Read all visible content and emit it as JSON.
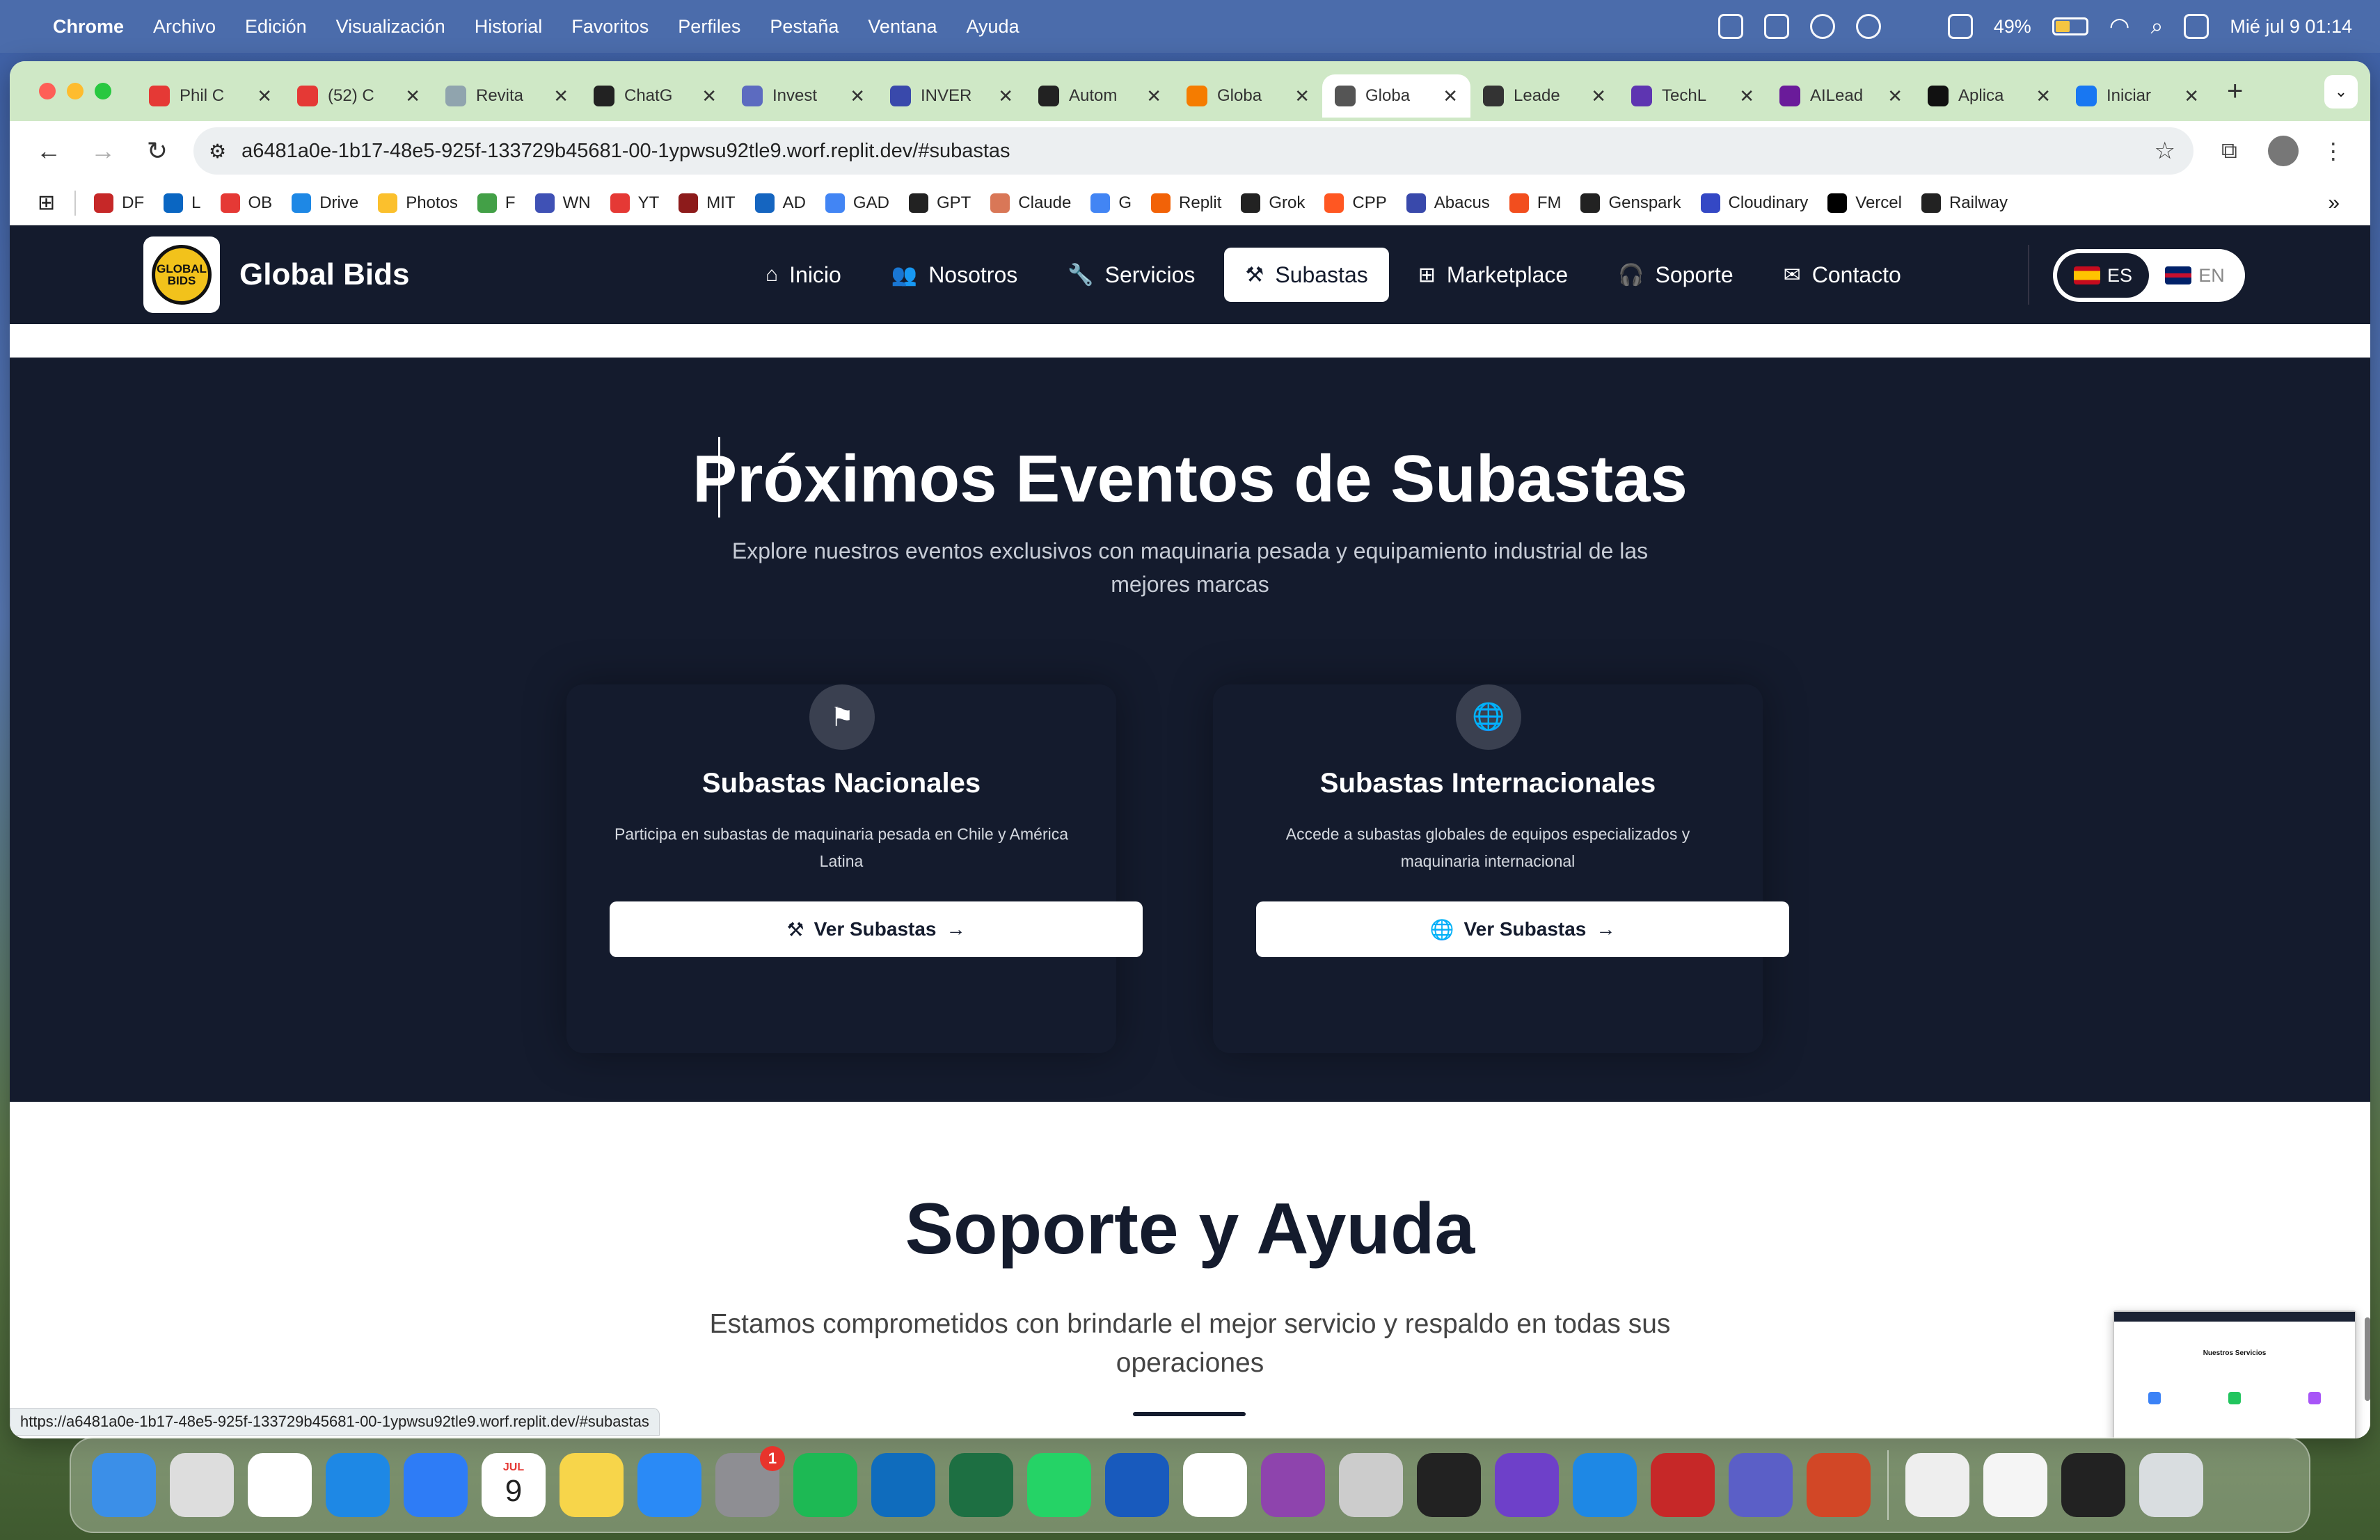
{
  "menubar": {
    "app_name": "Chrome",
    "items": [
      "Archivo",
      "Edición",
      "Visualización",
      "Historial",
      "Favoritos",
      "Perfiles",
      "Pestaña",
      "Ventana",
      "Ayuda"
    ],
    "battery_pct": "49%",
    "datetime": "Mié jul 9  01:14"
  },
  "tabs": [
    {
      "title": "Phil C",
      "color": "#e53935"
    },
    {
      "title": "(52) C",
      "color": "#e53935"
    },
    {
      "title": "Revita",
      "color": "#90a4ae"
    },
    {
      "title": "ChatG",
      "color": "#222"
    },
    {
      "title": "Invest",
      "color": "#5c6bc0"
    },
    {
      "title": "INVER",
      "color": "#3949ab"
    },
    {
      "title": "Autom",
      "color": "#222"
    },
    {
      "title": "Globa",
      "color": "#f57c00"
    },
    {
      "title": "Globa",
      "color": "#555",
      "active": true
    },
    {
      "title": "Leade",
      "color": "#333"
    },
    {
      "title": "TechL",
      "color": "#5e35b1"
    },
    {
      "title": "AILead",
      "color": "#6a1b9a"
    },
    {
      "title": "Aplica",
      "color": "#111"
    },
    {
      "title": "Iniciar",
      "color": "#1877f2"
    }
  ],
  "address_bar": {
    "url": "a6481a0e-1b17-48e5-925f-133729b45681-00-1ypwsu92tle9.worf.replit.dev/#subastas"
  },
  "bookmarks": [
    {
      "label": "DF",
      "color": "#c62828"
    },
    {
      "label": "L",
      "color": "#0a66c2"
    },
    {
      "label": "OB",
      "color": "#e53935"
    },
    {
      "label": "Drive",
      "color": "#1e88e5"
    },
    {
      "label": "Photos",
      "color": "#fbc02d"
    },
    {
      "label": "F",
      "color": "#43a047"
    },
    {
      "label": "WN",
      "color": "#3f51b5"
    },
    {
      "label": "YT",
      "color": "#e53935"
    },
    {
      "label": "MIT",
      "color": "#8d1b1b"
    },
    {
      "label": "AD",
      "color": "#1565c0"
    },
    {
      "label": "GAD",
      "color": "#4285f4"
    },
    {
      "label": "GPT",
      "color": "#222"
    },
    {
      "label": "Claude",
      "color": "#d97757"
    },
    {
      "label": "G",
      "color": "#4285f4"
    },
    {
      "label": "Replit",
      "color": "#f26207"
    },
    {
      "label": "Grok",
      "color": "#222"
    },
    {
      "label": "CPP",
      "color": "#ff5722"
    },
    {
      "label": "Abacus",
      "color": "#3949ab"
    },
    {
      "label": "FM",
      "color": "#f24e1e"
    },
    {
      "label": "Genspark",
      "color": "#222"
    },
    {
      "label": "Cloudinary",
      "color": "#3448c5"
    },
    {
      "label": "Vercel",
      "color": "#000"
    },
    {
      "label": "Railway",
      "color": "#222"
    }
  ],
  "site": {
    "logo_text": "GLOBAL BIDS",
    "brand": "Global Bids",
    "nav": [
      {
        "label": "Inicio",
        "icon": "home-icon",
        "glyph": "⌂"
      },
      {
        "label": "Nosotros",
        "icon": "users-icon",
        "glyph": "👥"
      },
      {
        "label": "Servicios",
        "icon": "wrench-icon",
        "glyph": "🔧"
      },
      {
        "label": "Subastas",
        "icon": "gavel-icon",
        "glyph": "⚒",
        "active": true
      },
      {
        "label": "Marketplace",
        "icon": "grid-icon",
        "glyph": "⊞"
      },
      {
        "label": "Soporte",
        "icon": "headset-icon",
        "glyph": "🎧"
      },
      {
        "label": "Contacto",
        "icon": "envelope-icon",
        "glyph": "✉"
      }
    ],
    "lang": {
      "es": "ES",
      "en": "EN",
      "active": "ES"
    }
  },
  "events": {
    "title": "Próximos Eventos de Subastas",
    "subtitle_line1": "Explore nuestros eventos exclusivos con maquinaria pesada y equipamiento industrial de las",
    "subtitle_line2": "mejores marcas",
    "cards": [
      {
        "title": "Subastas Nacionales",
        "desc_line1": "Participa en subastas de maquinaria pesada en Chile y América",
        "desc_line2": "Latina",
        "button": "Ver Subastas",
        "icon": "flag-icon",
        "glyph": "⚑",
        "btn_glyph": "⚒"
      },
      {
        "title": "Subastas Internacionales",
        "desc_line1": "Accede a subastas globales de equipos especializados y",
        "desc_line2": "maquinaria internacional",
        "button": "Ver Subastas",
        "icon": "globe-icon",
        "glyph": "🌐",
        "btn_glyph": "🌐"
      }
    ]
  },
  "support": {
    "title": "Soporte y Ayuda",
    "subtitle_line1": "Estamos comprometidos con brindarle el mejor servicio y respaldo en todas sus",
    "subtitle_line2": "operaciones"
  },
  "status_url": "https://a6481a0e-1b17-48e5-925f-133729b45681-00-1ypwsu92tle9.worf.replit.dev/#subastas",
  "thumbnail": {
    "heading": "Nuestros Servicios"
  },
  "calendar": {
    "month": "JUL",
    "day": "9"
  },
  "dock": [
    {
      "name": "finder",
      "color": "#3b8fe8"
    },
    {
      "name": "launchpad",
      "color": "#ddd"
    },
    {
      "name": "chrome",
      "color": "#fff"
    },
    {
      "name": "safari",
      "color": "#1e88e5"
    },
    {
      "name": "mail",
      "color": "#2e7cf6"
    },
    {
      "name": "calendar",
      "color": "#fff"
    },
    {
      "name": "notes",
      "color": "#f7d54a"
    },
    {
      "name": "keynote",
      "color": "#2a8af6"
    },
    {
      "name": "settings",
      "color": "#8e8e93",
      "badge": "1"
    },
    {
      "name": "spotify",
      "color": "#1db954"
    },
    {
      "name": "outlook",
      "color": "#0f6cbd"
    },
    {
      "name": "excel",
      "color": "#1d6f42"
    },
    {
      "name": "whatsapp",
      "color": "#25d366"
    },
    {
      "name": "word",
      "color": "#185abd"
    },
    {
      "name": "calendar-31",
      "color": "#fff"
    },
    {
      "name": "circle-app",
      "color": "#8e44ad"
    },
    {
      "name": "iphone-mirroring",
      "color": "#ccc"
    },
    {
      "name": "tasks-app",
      "color": "#222"
    },
    {
      "name": "github",
      "color": "#6e40c9"
    },
    {
      "name": "vscode",
      "color": "#1e88e5"
    },
    {
      "name": "acrobat",
      "color": "#c62828"
    },
    {
      "name": "teams",
      "color": "#5b5fc7"
    },
    {
      "name": "powerpoint",
      "color": "#d24726"
    }
  ]
}
